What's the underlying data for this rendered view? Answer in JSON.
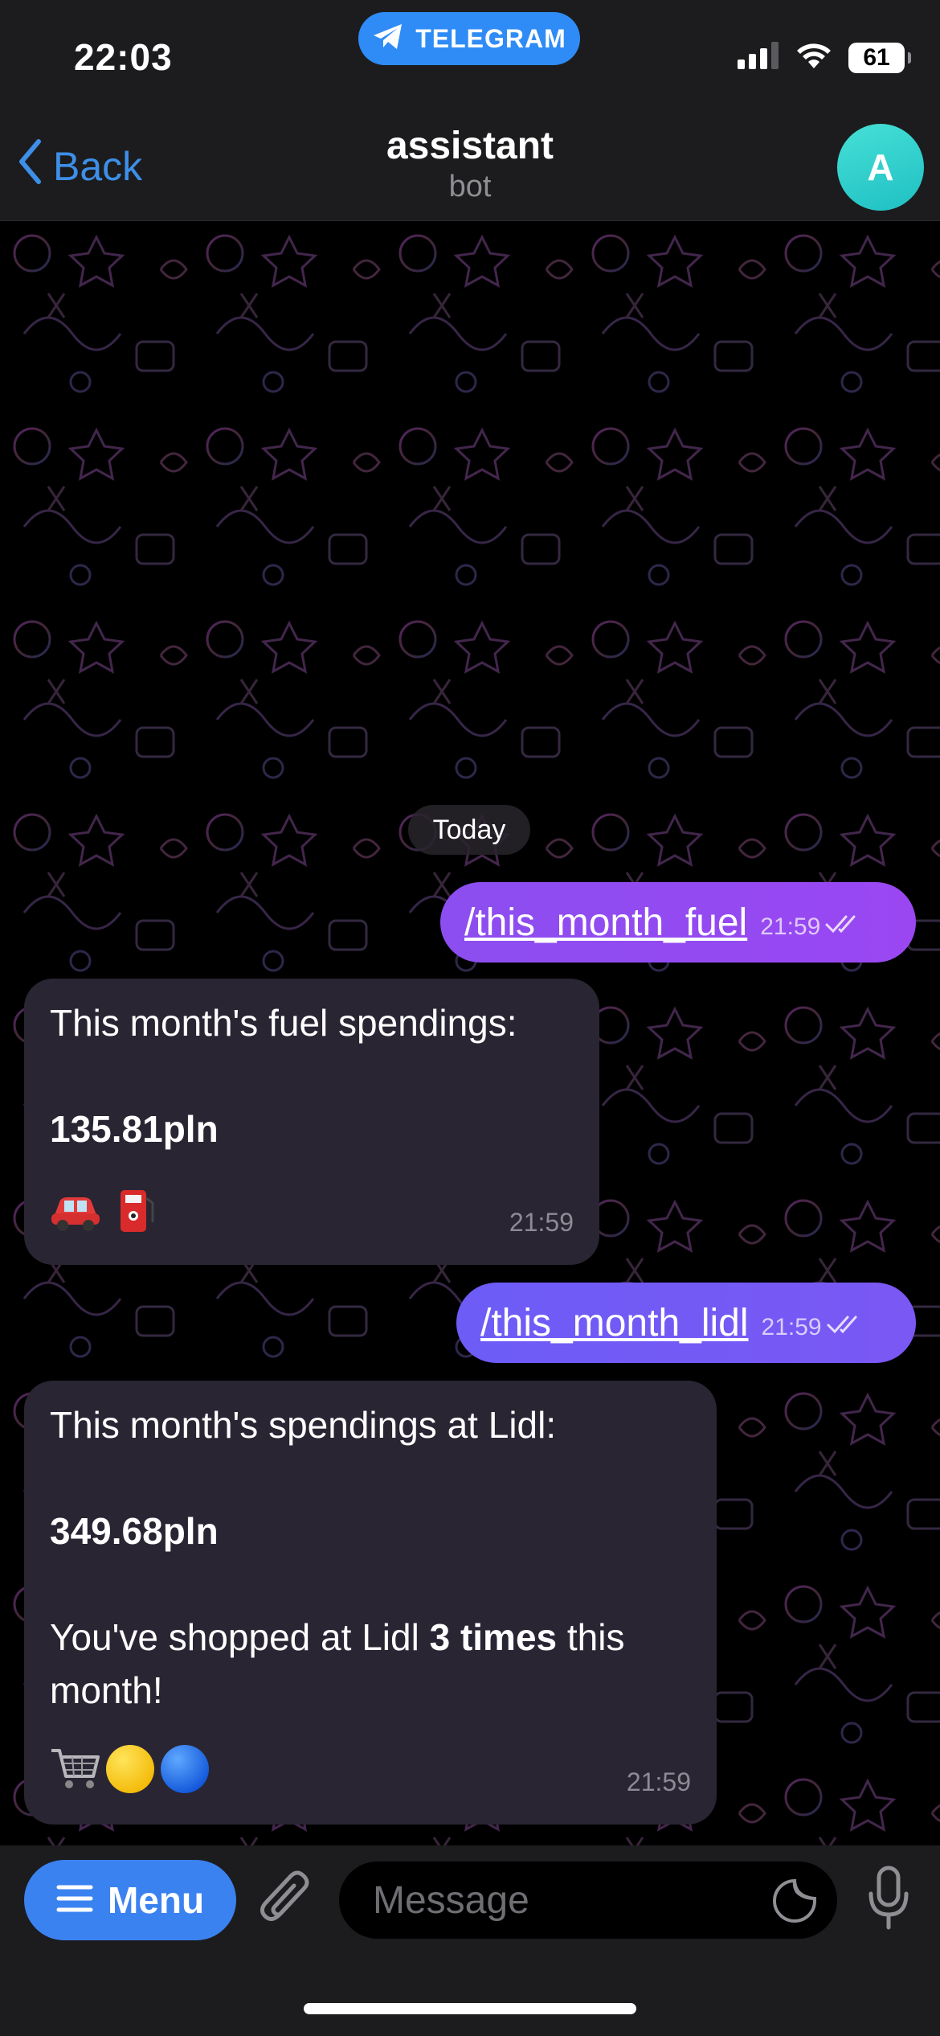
{
  "status_bar": {
    "time": "22:03",
    "app_pill": "TELEGRAM",
    "battery": "61"
  },
  "nav": {
    "back_label": "Back",
    "title": "assistant",
    "subtitle": "bot",
    "avatar_letter": "A"
  },
  "chat": {
    "date_chip": "Today",
    "messages": [
      {
        "direction": "out",
        "text": "/this_month_fuel",
        "time": "21:59"
      },
      {
        "direction": "in",
        "line1": "This month's fuel spendings:",
        "amount": "135.81pln",
        "emoji": [
          "🚗",
          "⛽"
        ],
        "time": "21:59"
      },
      {
        "direction": "out",
        "text": "/this_month_lidl",
        "time": "21:59"
      },
      {
        "direction": "in",
        "line1": "This month's spendings at Lidl:",
        "amount": "349.68pln",
        "note_pre": "You've shopped at Lidl ",
        "note_bold": "3 times",
        "note_post": " this month!",
        "emoji": [
          "🛒",
          "🟡",
          "🔵"
        ],
        "time": "21:59"
      }
    ]
  },
  "input_bar": {
    "menu_label": "Menu",
    "message_placeholder": "Message"
  },
  "colors": {
    "accent": "#3b82f1",
    "out_bubble_1": "#9a47f2",
    "out_bubble_2": "#7a58f4",
    "in_bubble": "#292533",
    "avatar": "#2fcfcf"
  }
}
